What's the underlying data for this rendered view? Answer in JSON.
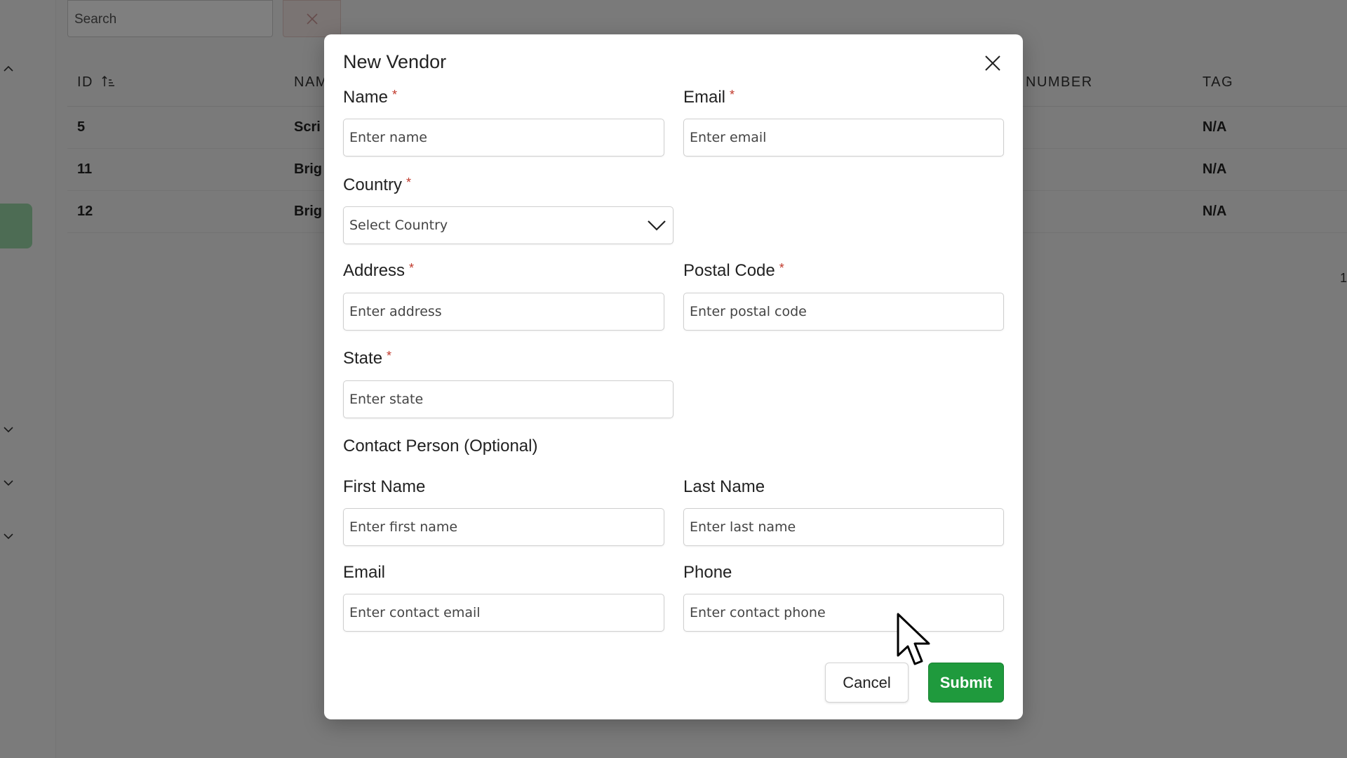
{
  "background": {
    "search_placeholder": "Search",
    "table": {
      "headers": [
        "ID",
        "NAM",
        "NUMBER",
        "TAG"
      ],
      "rows": [
        {
          "id": "5",
          "name": "Scri",
          "tag": "N/A"
        },
        {
          "id": "11",
          "name": "Brig",
          "tag": "N/A"
        },
        {
          "id": "12",
          "name": "Brig",
          "tag": "N/A"
        }
      ]
    },
    "page_number": "1"
  },
  "modal": {
    "title": "New Vendor",
    "required_marker": "*",
    "fields": {
      "name": {
        "label": "Name",
        "placeholder": "Enter name"
      },
      "email": {
        "label": "Email",
        "placeholder": "Enter email"
      },
      "country": {
        "label": "Country",
        "value": "Select Country"
      },
      "address": {
        "label": "Address",
        "placeholder": "Enter address"
      },
      "postal_code": {
        "label": "Postal Code",
        "placeholder": "Enter postal code"
      },
      "state": {
        "label": "State",
        "placeholder": "Enter state"
      }
    },
    "contact_section_title": "Contact Person (Optional)",
    "contact": {
      "first_name": {
        "label": "First Name",
        "placeholder": "Enter first name"
      },
      "last_name": {
        "label": "Last Name",
        "placeholder": "Enter last name"
      },
      "email": {
        "label": "Email",
        "placeholder": "Enter contact email"
      },
      "phone": {
        "label": "Phone",
        "placeholder": "Enter contact phone"
      }
    },
    "buttons": {
      "cancel": "Cancel",
      "submit": "Submit"
    }
  },
  "colors": {
    "submit": "#1f9a3d",
    "required": "#c0392b"
  }
}
